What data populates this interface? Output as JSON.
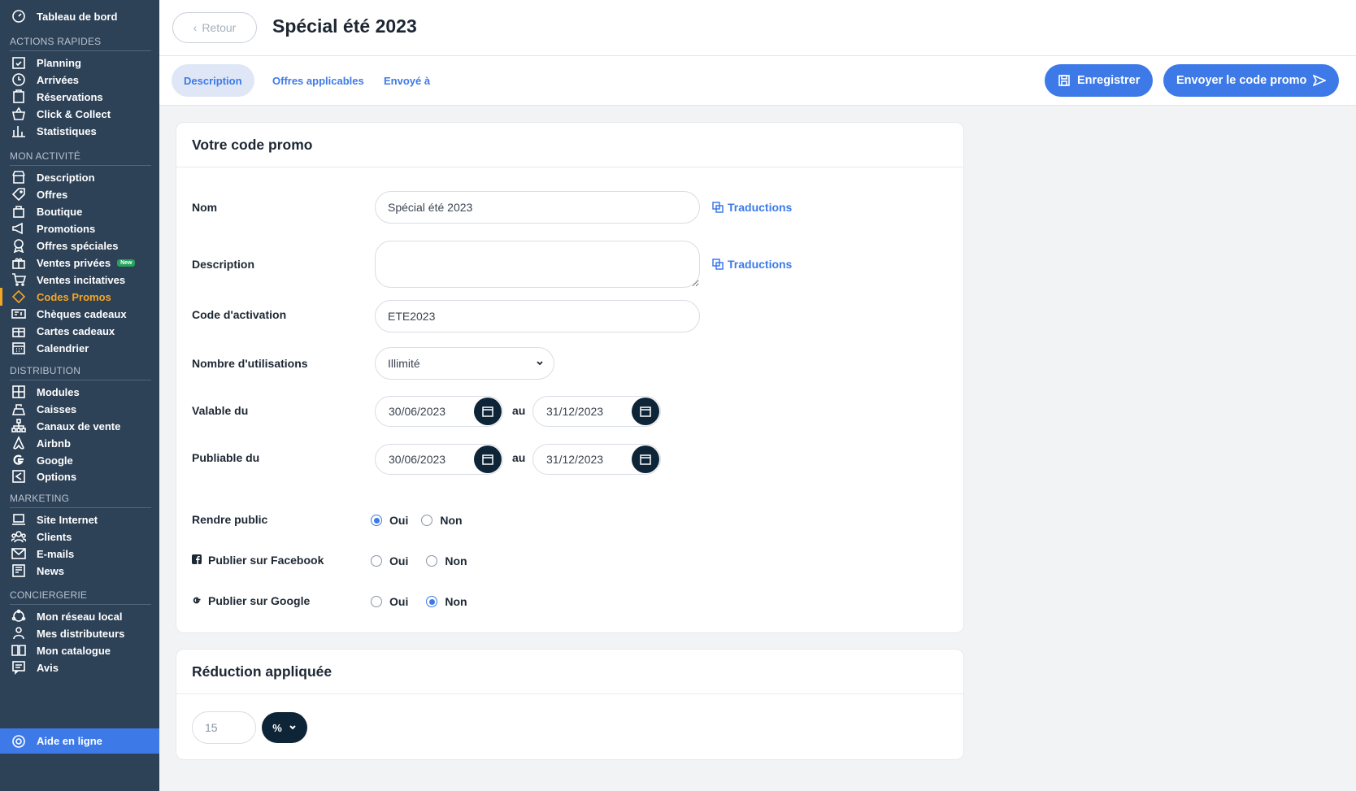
{
  "sidebar": {
    "dashboard": "Tableau de bord",
    "sections": [
      "ACTIONS RAPIDES",
      "MON ACTIVITÉ",
      "DISTRIBUTION",
      "MARKETING",
      "CONCIERGERIE"
    ],
    "actions": [
      "Planning",
      "Arrivées",
      "Réservations",
      "Click & Collect",
      "Statistiques"
    ],
    "activity": [
      "Description",
      "Offres",
      "Boutique",
      "Promotions",
      "Offres spéciales",
      "Ventes privées",
      "Ventes incitatives",
      "Codes Promos",
      "Chèques cadeaux",
      "Cartes cadeaux",
      "Calendrier"
    ],
    "new_badge": "New",
    "distribution": [
      "Modules",
      "Caisses",
      "Canaux de vente",
      "Airbnb",
      "Google",
      "Options"
    ],
    "marketing": [
      "Site Internet",
      "Clients",
      "E-mails",
      "News"
    ],
    "concierge": [
      "Mon réseau local",
      "Mes distributeurs",
      "Mon catalogue",
      "Avis"
    ],
    "help": "Aide en ligne",
    "accent": "#f5a623"
  },
  "header": {
    "back": "Retour",
    "title": "Spécial été 2023"
  },
  "tabs": {
    "items": [
      "Description",
      "Offres applicables",
      "Envoyé à"
    ],
    "save": "Enregistrer",
    "send": "Envoyer le code promo"
  },
  "promo": {
    "title": "Votre code promo",
    "name_label": "Nom",
    "name_value": "Spécial été 2023",
    "translations": "Traductions",
    "description_label": "Description",
    "description_value": "",
    "code_label": "Code d'activation",
    "code_value": "ETE2023",
    "uses_label": "Nombre d'utilisations",
    "uses_value": "Illimité",
    "valid_label": "Valable du",
    "valid_from": "30/06/2023",
    "valid_to": "31/12/2023",
    "publish_label": "Publiable du",
    "publish_from": "30/06/2023",
    "publish_to": "31/12/2023",
    "to": "au",
    "public_label": "Rendre public",
    "facebook_label": "Publier sur Facebook",
    "google_label": "Publier sur Google",
    "yes": "Oui",
    "no": "Non",
    "public_choice": "Oui",
    "facebook_choice": "",
    "google_choice": "Non"
  },
  "reduction": {
    "title": "Réduction appliquée",
    "value": "15",
    "unit": "%"
  },
  "colors": {
    "primary": "#3d7ae8",
    "sidebar": "#2d4157",
    "dark": "#0e2537"
  }
}
